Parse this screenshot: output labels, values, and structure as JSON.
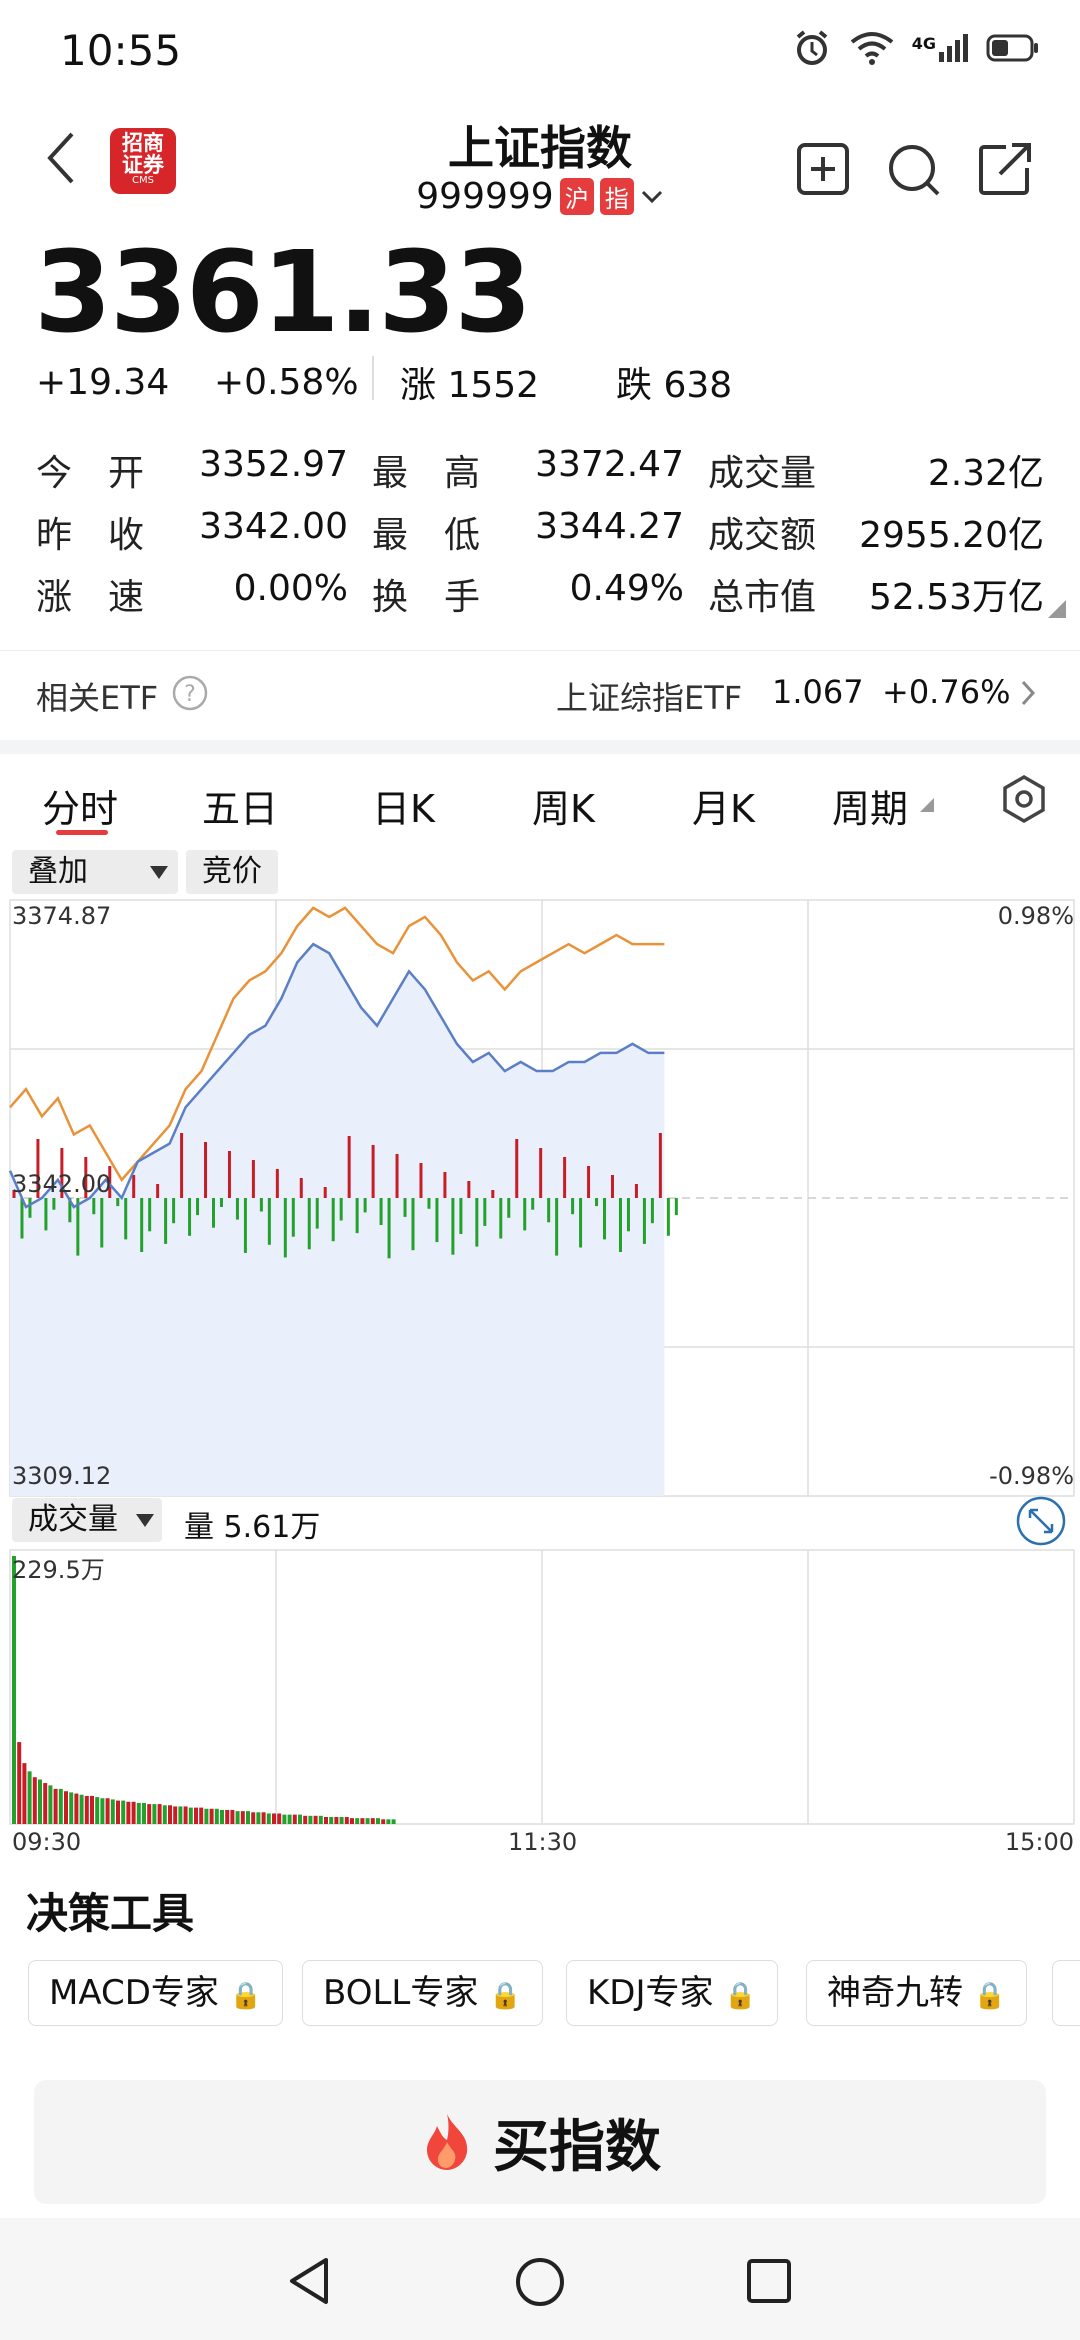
{
  "status": {
    "time": "10:55",
    "network": "4G"
  },
  "header": {
    "title": "上证指数",
    "code": "999999",
    "tag1": "沪",
    "tag2": "指",
    "logo_line1": "招商",
    "logo_line2": "证券",
    "logo_sub": "CMS"
  },
  "quote": {
    "price": "3361.33",
    "change": "+19.34",
    "change_pct": "+0.58%",
    "up_label": "涨 1552",
    "down_label": "跌 638"
  },
  "stats": [
    {
      "label": "今　开",
      "value": "3352.97"
    },
    {
      "label": "最　高",
      "value": "3372.47"
    },
    {
      "label": "成交量",
      "value": "2.32亿"
    },
    {
      "label": "昨　收",
      "value": "3342.00"
    },
    {
      "label": "最　低",
      "value": "3344.27"
    },
    {
      "label": "成交额",
      "value": "2955.20亿"
    },
    {
      "label": "涨　速",
      "value": "0.00%"
    },
    {
      "label": "换　手",
      "value": "0.49%"
    },
    {
      "label": "总市值",
      "value": "52.53万亿"
    }
  ],
  "etf": {
    "label": "相关ETF",
    "name": "上证综指ETF",
    "price": "1.067",
    "pct": "+0.76%"
  },
  "tabs": [
    "分时",
    "五日",
    "日K",
    "周K",
    "月K",
    "周期"
  ],
  "chips": {
    "overlay": "叠加",
    "auction": "竞价"
  },
  "chart_data": [
    {
      "type": "line",
      "title": "",
      "y_labels": {
        "top": "3374.87",
        "mid": "3342.00",
        "bottom": "3309.12",
        "top_pct": "0.98%",
        "bottom_pct": "-0.98%"
      },
      "ylim": [
        3309.12,
        3374.87
      ],
      "x_labels": [
        "09:30",
        "11:30",
        "15:00"
      ],
      "series": [
        {
          "color": "#e8923a",
          "values": [
            3352,
            3354,
            3351,
            3353,
            3349,
            3350,
            3347,
            3344,
            3346,
            3348,
            3350,
            3354,
            3356,
            3360,
            3364,
            3366,
            3367,
            3369,
            3372,
            3374,
            3373,
            3374,
            3372,
            3370,
            3369,
            3372,
            3373,
            3371,
            3368,
            3366,
            3367,
            3365,
            3367,
            3368,
            3369,
            3370,
            3369,
            3370,
            3371,
            3370,
            3370,
            3370
          ]
        },
        {
          "color": "#5b7fc7",
          "values": [
            3345,
            3341,
            3342,
            3344,
            3341,
            3342,
            3344,
            3342,
            3346,
            3347,
            3348,
            3352,
            3354,
            3356,
            3358,
            3360,
            3361,
            3364,
            3368,
            3370,
            3369,
            3366,
            3363,
            3361,
            3364,
            3367,
            3365,
            3362,
            3359,
            3357,
            3358,
            3356,
            3357,
            3356,
            3356,
            3357,
            3357,
            3358,
            3358,
            3359,
            3358,
            3358
          ]
        }
      ]
    },
    {
      "type": "bar",
      "title": "",
      "series_name": "成交量",
      "label": "量 5.61万",
      "y_top_label": "229.5万",
      "x_labels": [
        "09:30",
        "11:30",
        "15:00"
      ],
      "values": [
        229,
        70,
        52,
        45,
        40,
        38,
        35,
        33,
        30,
        30,
        28,
        27,
        26,
        25,
        24,
        24,
        23,
        22,
        22,
        21,
        20,
        20,
        19,
        19,
        18,
        18,
        17,
        17,
        17,
        16,
        16,
        15,
        15,
        15,
        14,
        14,
        14,
        13,
        13,
        13,
        12,
        12,
        12,
        11,
        11,
        11,
        10,
        10,
        10,
        9,
        9,
        9,
        8,
        8,
        8,
        8,
        7,
        7,
        7,
        7,
        6,
        6,
        6,
        6,
        6,
        5,
        5,
        5,
        5,
        5,
        5,
        4,
        4,
        4
      ],
      "colors": [
        "g",
        "r",
        "r",
        "g",
        "r",
        "g",
        "r",
        "g",
        "r",
        "g",
        "r",
        "g",
        "r",
        "g",
        "r",
        "r",
        "g",
        "g",
        "r",
        "g",
        "r",
        "g",
        "r",
        "r",
        "g",
        "g",
        "r",
        "g",
        "r",
        "g",
        "r",
        "r",
        "g",
        "r",
        "g",
        "r",
        "r",
        "g",
        "r",
        "g",
        "g",
        "r",
        "r",
        "g",
        "r",
        "g",
        "r",
        "g",
        "r",
        "g",
        "r",
        "r",
        "g",
        "g",
        "r",
        "g",
        "r",
        "g",
        "r",
        "g",
        "r",
        "g",
        "r",
        "g",
        "r",
        "r",
        "g",
        "r",
        "g",
        "r",
        "g",
        "r",
        "g",
        "g"
      ]
    }
  ],
  "volume_chip": "成交量",
  "tools": {
    "title": "决策工具",
    "items": [
      "MACD专家",
      "BOLL专家",
      "KDJ专家",
      "神奇九转"
    ]
  },
  "buy": {
    "label": "买指数"
  }
}
